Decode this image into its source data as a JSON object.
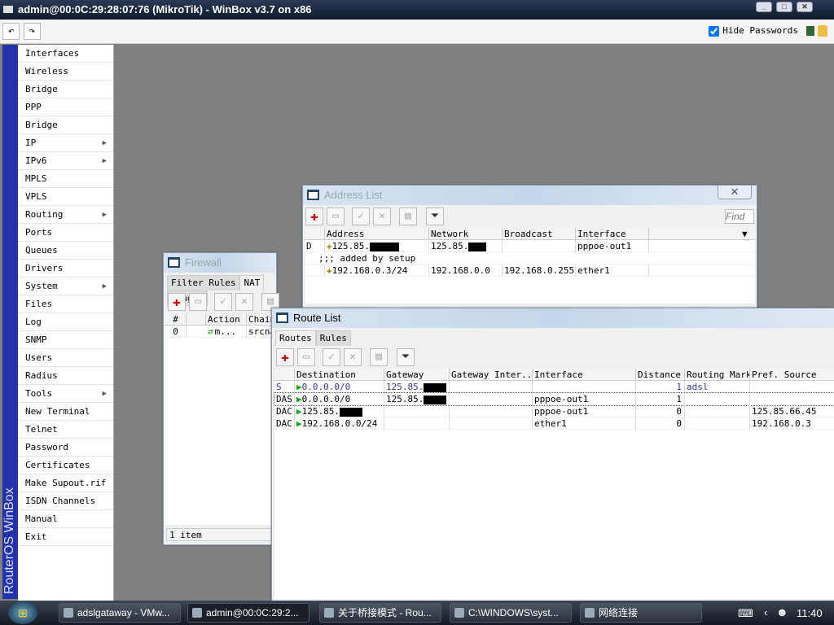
{
  "window": {
    "title": "admin@00:0C:29:28:07:76 (MikroTik) - WinBox v3.7 on x86"
  },
  "toolbar": {
    "undo_icon": "undo-icon",
    "redo_icon": "redo-icon",
    "hide_passwords_label": "Hide Passwords",
    "hide_passwords_checked": true
  },
  "sidebar": {
    "brand": "RouterOS WinBox",
    "items": [
      {
        "label": "Interfaces"
      },
      {
        "label": "Wireless"
      },
      {
        "label": "Bridge"
      },
      {
        "label": "PPP"
      },
      {
        "label": "Bridge"
      },
      {
        "label": "IP",
        "submenu": true
      },
      {
        "label": "IPv6",
        "submenu": true
      },
      {
        "label": "MPLS"
      },
      {
        "label": "VPLS"
      },
      {
        "label": "Routing",
        "submenu": true
      },
      {
        "label": "Ports"
      },
      {
        "label": "Queues"
      },
      {
        "label": "Drivers"
      },
      {
        "label": "System",
        "submenu": true
      },
      {
        "label": "Files"
      },
      {
        "label": "Log"
      },
      {
        "label": "SNMP"
      },
      {
        "label": "Users"
      },
      {
        "label": "Radius"
      },
      {
        "label": "Tools",
        "submenu": true
      },
      {
        "label": "New Terminal"
      },
      {
        "label": "Telnet"
      },
      {
        "label": "Password"
      },
      {
        "label": "Certificates"
      },
      {
        "label": "Make Supout.rif"
      },
      {
        "label": "ISDN Channels"
      },
      {
        "label": "Manual"
      },
      {
        "label": "Exit"
      }
    ]
  },
  "firewall": {
    "title": "Firewall",
    "tabs": [
      "Filter Rules",
      "NAT",
      "Mangle"
    ],
    "selected_tab": "NAT",
    "columns": [
      "#",
      "",
      "Action",
      "Chain"
    ],
    "rows": [
      {
        "num": "0",
        "action": "m...",
        "chain": "srcnat"
      }
    ],
    "status": "1 item"
  },
  "address_list": {
    "title": "Address List",
    "find_placeholder": "Find",
    "columns": [
      "",
      "Address",
      "Network",
      "Broadcast",
      "Interface"
    ],
    "rows": [
      {
        "flag": "D",
        "address": "125.85.",
        "network": "125.85.",
        "broadcast": "",
        "interface": "pppoe-out1"
      },
      {
        "comment": ";;; added by setup"
      },
      {
        "flag": "",
        "address": "192.168.0.3/24",
        "network": "192.168.0.0",
        "broadcast": "192.168.0.255",
        "interface": "ether1"
      }
    ]
  },
  "route_list": {
    "title": "Route List",
    "tabs": [
      "Routes",
      "Rules"
    ],
    "selected_tab": "Routes",
    "columns": [
      "",
      "Destination",
      "Gateway",
      "Gateway Inter...",
      "Interface",
      "Distance",
      "Routing Mark",
      "Pref. Source"
    ],
    "rows": [
      {
        "flag": "S",
        "destination": "0.0.0.0/0",
        "gateway": "125.85.",
        "gw_interface": "",
        "interface": "",
        "distance": "1",
        "routing_mark": "adsl",
        "pref_source": ""
      },
      {
        "flag": "DAS",
        "destination": "0.0.0.0/0",
        "gateway": "125.85.",
        "gw_interface": "",
        "interface": "pppoe-out1",
        "distance": "1",
        "routing_mark": "",
        "pref_source": ""
      },
      {
        "flag": "DAC",
        "destination": "125.85.",
        "gateway": "",
        "gw_interface": "",
        "interface": "pppoe-out1",
        "distance": "0",
        "routing_mark": "",
        "pref_source": "125.85.66.45"
      },
      {
        "flag": "DAC",
        "destination": "192.168.0.0/24",
        "gateway": "",
        "gw_interface": "",
        "interface": "ether1",
        "distance": "0",
        "routing_mark": "",
        "pref_source": "192.168.0.3"
      }
    ]
  },
  "taskbar": {
    "tasks": [
      "adslgataway - VMw...",
      "admin@00:0C:29:2...",
      "关于桥接模式 - Rou...",
      "C:\\WINDOWS\\syst...",
      "网络连接"
    ],
    "active_task": 1,
    "clock": "11:40"
  },
  "colors": {
    "desktop": "#808080",
    "sidebar_brand": "#2233aa",
    "static_route_text": "#333399"
  }
}
